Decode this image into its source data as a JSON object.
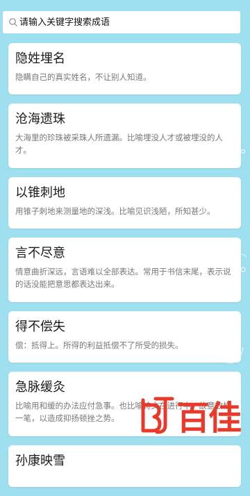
{
  "search": {
    "placeholder": "请输入关键字搜索成语",
    "icon": "search-icon"
  },
  "idioms": [
    {
      "title": "隐姓埋名",
      "desc": "隐瞒自己的真实姓名，不让别人知道。"
    },
    {
      "title": "沧海遗珠",
      "desc": "大海里的珍珠被采珠人所遗漏。比喻埋没人才或被埋没的人才。"
    },
    {
      "title": "以锥刺地",
      "desc": "用锥子刺地来测量地的深浅。比喻见识浅陋，所知甚少。"
    },
    {
      "title": "言不尽意",
      "desc": "情意曲折深远，言语难以全部表达。常用于书信末尾，表示说的话没能把意思都表达出来。"
    },
    {
      "title": "得不偿失",
      "desc": "偿：抵得上。所得的利益抵偿不了所受的损失。"
    },
    {
      "title": "急脉缓灸",
      "desc": "比喻用和缓的办法应付急事。也比喻诗文在进行中，故意放松一笔，以造成抑扬顿挫之势。"
    },
    {
      "title": "孙康映雪",
      "desc": ""
    }
  ],
  "watermark": {
    "text": "百佳",
    "color": "#e8392a"
  },
  "colors": {
    "background": "#9fe0f0",
    "card": "#ffffff",
    "title": "#1a1a1a",
    "desc": "#777777"
  }
}
